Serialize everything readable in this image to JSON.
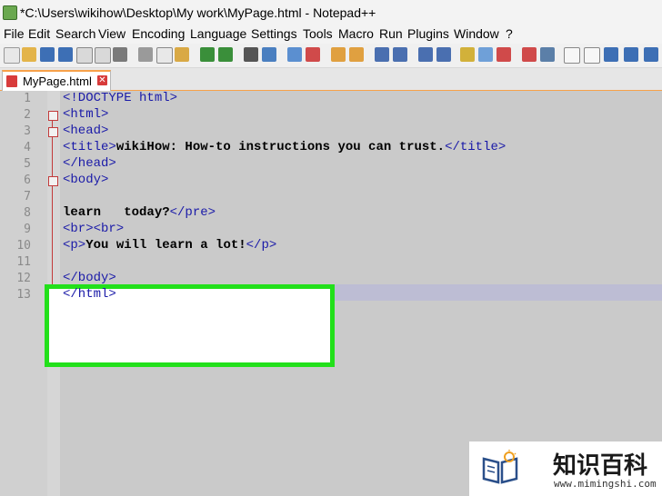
{
  "window": {
    "title": "*C:\\Users\\wikihow\\Desktop\\My work\\MyPage.html - Notepad++"
  },
  "menu": [
    "File",
    "Edit",
    "Search",
    "View",
    "Encoding",
    "Language",
    "Settings",
    "Tools",
    "Macro",
    "Run",
    "Plugins",
    "Window",
    "?"
  ],
  "tab": {
    "label": "MyPage.html",
    "close": "✕"
  },
  "line_numbers": [
    "1",
    "2",
    "3",
    "4",
    "5",
    "6",
    "7",
    "8",
    "9",
    "10",
    "11",
    "12",
    "13"
  ],
  "code": {
    "l1": "<!DOCTYPE html>",
    "l2": "<html>",
    "l3": "<head>",
    "l4_open": "<title>",
    "l4_text": "wikiHow: How-to instructions you can trust.",
    "l4_close": "</title>",
    "l5": "</head>",
    "l6": "<body>",
    "l8_text": "learn   today?",
    "l8_close": "</pre>",
    "l9": "<br><br>",
    "l10_open": "<p>",
    "l10_text": "You will learn a lot!",
    "l10_close": "</p>",
    "l12": "</body>",
    "l13": "</html>"
  },
  "watermark": {
    "cn": "知识百科",
    "url": "www.mimingshi.com"
  },
  "colors": {
    "tag": "#1a1aa8",
    "highlight": "#22e01a",
    "tab_accent": "#f7a14a"
  }
}
